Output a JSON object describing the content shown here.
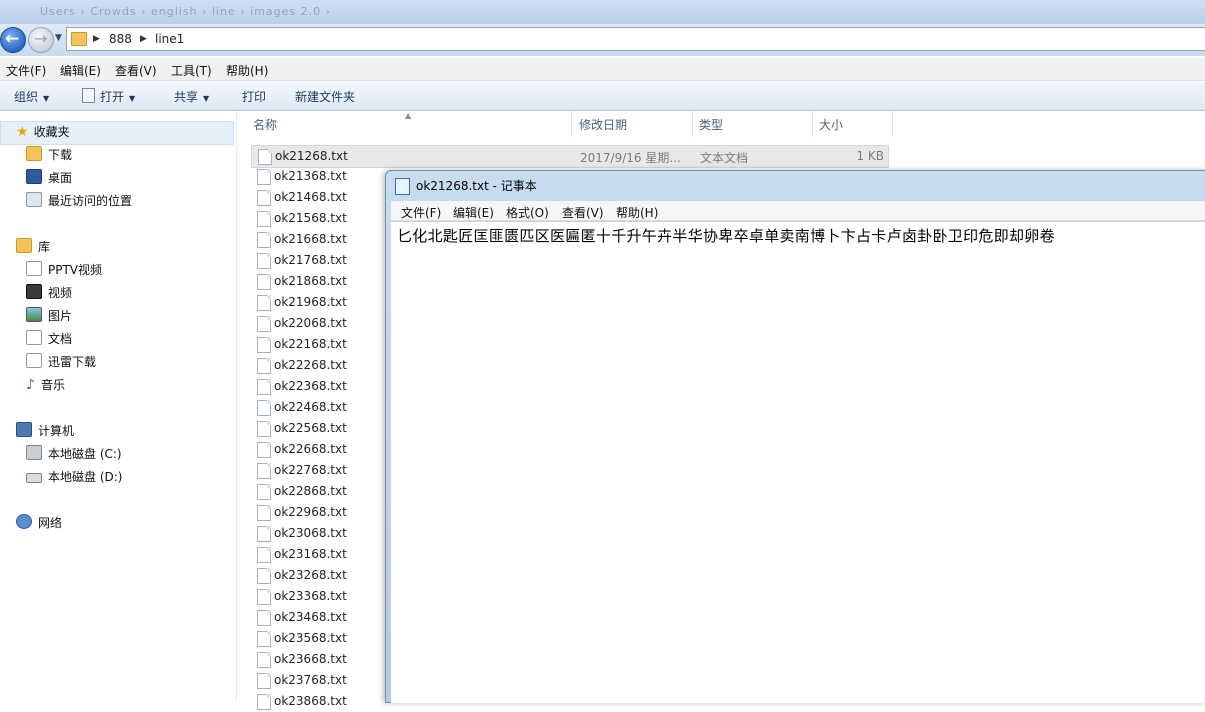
{
  "window": {
    "blurred_title": "Users › Crowds › english › line › images 2.0 ›",
    "breadcrumbs": [
      "888",
      "line1"
    ]
  },
  "menu": [
    "文件(F)",
    "编辑(E)",
    "查看(V)",
    "工具(T)",
    "帮助(H)"
  ],
  "toolbar": {
    "organize": "组织",
    "open": "打开",
    "share": "共享",
    "print": "打印",
    "new_folder": "新建文件夹"
  },
  "nav": {
    "favorites": "收藏夹",
    "fav_items": [
      "下载",
      "桌面",
      "最近访问的位置"
    ],
    "libraries": "库",
    "lib_items": [
      "PPTV视频",
      "视频",
      "图片",
      "文档",
      "迅雷下载",
      "音乐"
    ],
    "computer": "计算机",
    "comp_items": [
      "本地磁盘 (C:)",
      "本地磁盘 (D:)"
    ],
    "network": "网络"
  },
  "columns": {
    "name": "名称",
    "date": "修改日期",
    "type": "类型",
    "size": "大小"
  },
  "files": [
    "ok21268.txt",
    "ok21368.txt",
    "ok21468.txt",
    "ok21568.txt",
    "ok21668.txt",
    "ok21768.txt",
    "ok21868.txt",
    "ok21968.txt",
    "ok22068.txt",
    "ok22168.txt",
    "ok22268.txt",
    "ok22368.txt",
    "ok22468.txt",
    "ok22568.txt",
    "ok22668.txt",
    "ok22768.txt",
    "ok22868.txt",
    "ok22968.txt",
    "ok23068.txt",
    "ok23168.txt",
    "ok23268.txt",
    "ok23368.txt",
    "ok23468.txt",
    "ok23568.txt",
    "ok23668.txt",
    "ok23768.txt",
    "ok23868.txt"
  ],
  "selected_file": {
    "date": "2017/9/16 星期...",
    "type": "文本文档",
    "size": "1 KB"
  },
  "notepad": {
    "title": "ok21268.txt - 记事本",
    "menu": [
      "文件(F)",
      "编辑(E)",
      "格式(O)",
      "查看(V)",
      "帮助(H)"
    ],
    "content": "匕化北匙匠匡匪匮匹区医匾匿十千升午卉半华协卑卒卓单卖南博卜卞占卡卢卤卦卧卫印危即却卵卷"
  },
  "colors": {
    "accent": "#2a66c3",
    "selection": "#e8e8e8",
    "folder": "#f2c45a"
  }
}
